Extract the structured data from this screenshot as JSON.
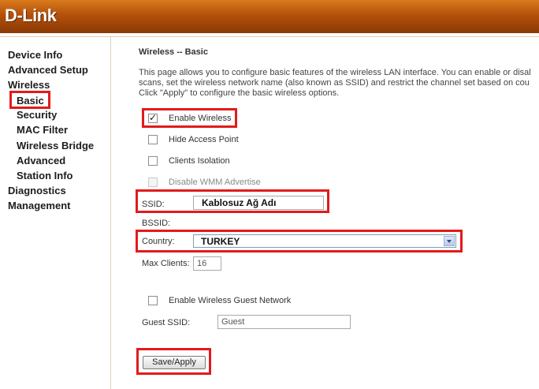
{
  "brand": {
    "logo_text": "D-Link"
  },
  "sidebar": {
    "items": [
      {
        "label": "Device Info"
      },
      {
        "label": "Advanced Setup"
      },
      {
        "label": "Wireless"
      },
      {
        "label": "Basic"
      },
      {
        "label": "Security"
      },
      {
        "label": "MAC Filter"
      },
      {
        "label": "Wireless Bridge"
      },
      {
        "label": "Advanced"
      },
      {
        "label": "Station Info"
      },
      {
        "label": "Diagnostics"
      },
      {
        "label": "Management"
      }
    ]
  },
  "main": {
    "title": "Wireless -- Basic",
    "description": [
      "This page allows you to configure basic features of the wireless LAN interface. You can enable or disal",
      "scans, set the wireless network name (also known as SSID) and restrict the channel set based on cou",
      "Click \"Apply\" to configure the basic wireless options."
    ],
    "options": {
      "enable_wireless": {
        "label": "Enable Wireless",
        "checked": true
      },
      "hide_access_point": {
        "label": "Hide Access Point",
        "checked": false
      },
      "clients_isolation": {
        "label": "Clients Isolation",
        "checked": false
      },
      "disable_wmm": {
        "label": "Disable WMM Advertise",
        "checked": false
      }
    },
    "ssid": {
      "label": "SSID:",
      "value": "Kablosuz Ağ Adı"
    },
    "bssid": {
      "label": "BSSID:"
    },
    "country": {
      "label": "Country:",
      "value": "TURKEY"
    },
    "max_clients": {
      "label": "Max Clients:",
      "value": "16"
    },
    "guest": {
      "enable_label": "Enable Wireless Guest Network",
      "checked": false,
      "ssid_label": "Guest SSID:",
      "ssid_value": "Guest"
    },
    "save_label": "Save/Apply"
  },
  "colors": {
    "header": "#b4500a",
    "highlight": "#e21b1b"
  },
  "icons": {
    "checkbox": "check-icon",
    "dropdown": "chevron-down-icon"
  }
}
